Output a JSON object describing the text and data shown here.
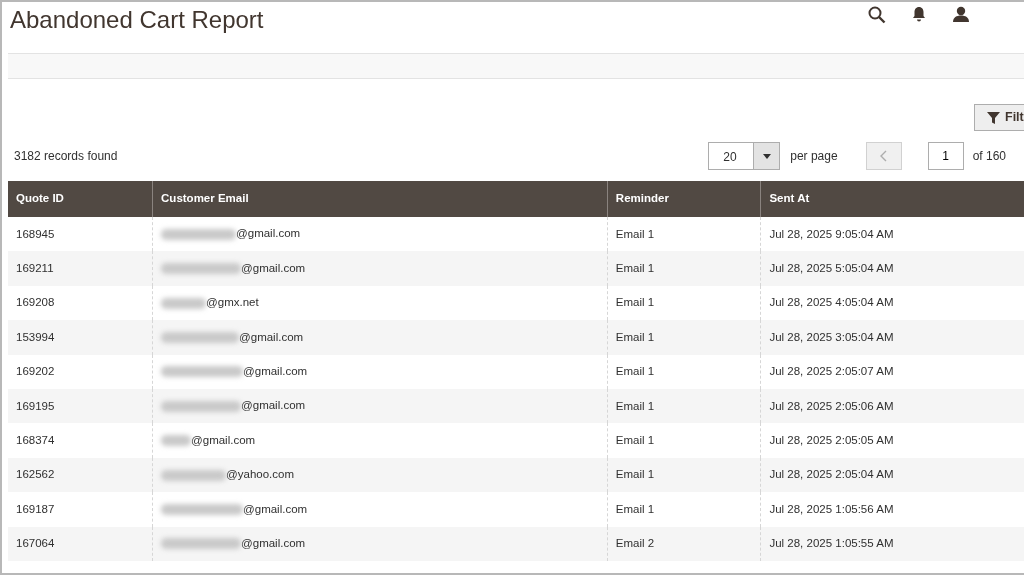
{
  "header": {
    "title": "Abandoned Cart Report"
  },
  "toolbar": {
    "filters_button": "Filt",
    "records_found": "3182 records found",
    "per_page_value": "20",
    "per_page_label": "per page",
    "page_value": "1",
    "page_total": "of 160",
    "prev_disabled": true
  },
  "table": {
    "columns": [
      "Quote ID",
      "Customer Email",
      "Reminder",
      "Sent At"
    ],
    "rows": [
      {
        "quote_id": "168945",
        "email": "@gmail.com",
        "reminder": "Email 1",
        "sent_at": "Jul 28, 2025 9:05:04 AM"
      },
      {
        "quote_id": "169211",
        "email": "@gmail.com",
        "reminder": "Email 1",
        "sent_at": "Jul 28, 2025 5:05:04 AM"
      },
      {
        "quote_id": "169208",
        "email": "@gmx.net",
        "reminder": "Email 1",
        "sent_at": "Jul 28, 2025 4:05:04 AM"
      },
      {
        "quote_id": "153994",
        "email": "@gmail.com",
        "reminder": "Email 1",
        "sent_at": "Jul 28, 2025 3:05:04 AM"
      },
      {
        "quote_id": "169202",
        "email": "@gmail.com",
        "reminder": "Email 1",
        "sent_at": "Jul 28, 2025 2:05:07 AM"
      },
      {
        "quote_id": "169195",
        "email": "@gmail.com",
        "reminder": "Email 1",
        "sent_at": "Jul 28, 2025 2:05:06 AM"
      },
      {
        "quote_id": "168374",
        "email": "@gmail.com",
        "reminder": "Email 1",
        "sent_at": "Jul 28, 2025 2:05:05 AM"
      },
      {
        "quote_id": "162562",
        "email": "@yahoo.com",
        "reminder": "Email 1",
        "sent_at": "Jul 28, 2025 2:05:04 AM"
      },
      {
        "quote_id": "169187",
        "email": "@gmail.com",
        "reminder": "Email 1",
        "sent_at": "Jul 28, 2025 1:05:56 AM"
      },
      {
        "quote_id": "167064",
        "email": "@gmail.com",
        "reminder": "Email 2",
        "sent_at": "Jul 28, 2025 1:05:55 AM"
      }
    ]
  }
}
